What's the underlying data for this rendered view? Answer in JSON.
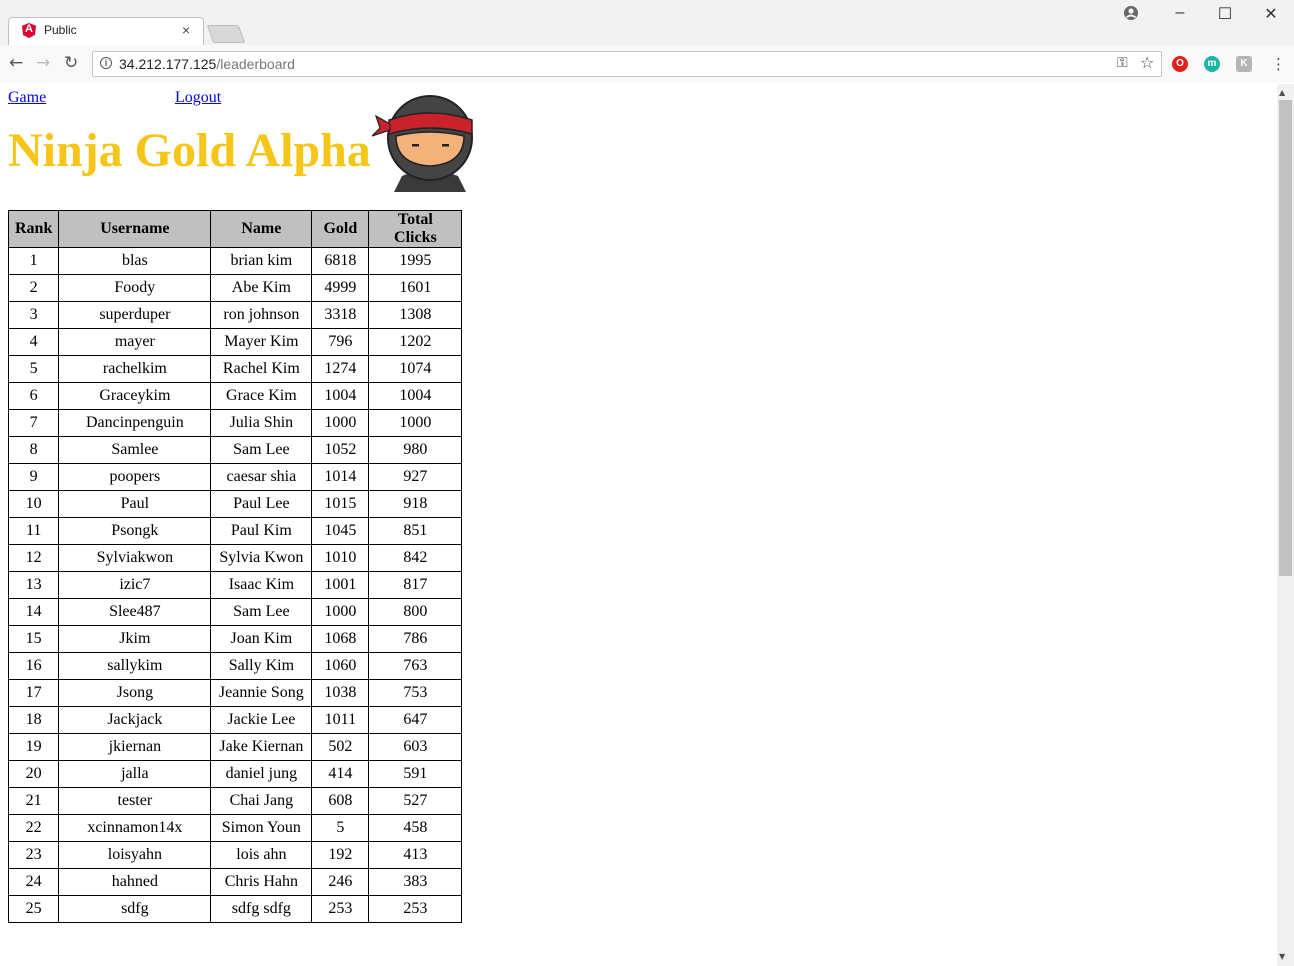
{
  "browser": {
    "tab_title": "Public",
    "tab_close": "×",
    "url_host": "34.212.177.125",
    "url_path": "/leaderboard",
    "window_controls": [
      "–",
      "☐",
      "✕"
    ]
  },
  "nav": {
    "game_link": "Game",
    "logout_link": "Logout"
  },
  "page": {
    "title": "Ninja Gold Alpha"
  },
  "table": {
    "headers": [
      "Rank",
      "Username",
      "Name",
      "Gold",
      "Total Clicks"
    ],
    "rows": [
      [
        "1",
        "blas",
        "brian kim",
        "6818",
        "1995"
      ],
      [
        "2",
        "Foody",
        "Abe Kim",
        "4999",
        "1601"
      ],
      [
        "3",
        "superduper",
        "ron johnson",
        "3318",
        "1308"
      ],
      [
        "4",
        "mayer",
        "Mayer Kim",
        "796",
        "1202"
      ],
      [
        "5",
        "rachelkim",
        "Rachel Kim",
        "1274",
        "1074"
      ],
      [
        "6",
        "Graceykim",
        "Grace Kim",
        "1004",
        "1004"
      ],
      [
        "7",
        "Dancinpenguin",
        "Julia Shin",
        "1000",
        "1000"
      ],
      [
        "8",
        "Samlee",
        "Sam Lee",
        "1052",
        "980"
      ],
      [
        "9",
        "poopers",
        "caesar shia",
        "1014",
        "927"
      ],
      [
        "10",
        "Paul",
        "Paul Lee",
        "1015",
        "918"
      ],
      [
        "11",
        "Psongk",
        "Paul Kim",
        "1045",
        "851"
      ],
      [
        "12",
        "Sylviakwon",
        "Sylvia Kwon",
        "1010",
        "842"
      ],
      [
        "13",
        "izic7",
        "Isaac Kim",
        "1001",
        "817"
      ],
      [
        "14",
        "Slee487",
        "Sam Lee",
        "1000",
        "800"
      ],
      [
        "15",
        "Jkim",
        "Joan Kim",
        "1068",
        "786"
      ],
      [
        "16",
        "sallykim",
        "Sally Kim",
        "1060",
        "763"
      ],
      [
        "17",
        "Jsong",
        "Jeannie Song",
        "1038",
        "753"
      ],
      [
        "18",
        "Jackjack",
        "Jackie Lee",
        "1011",
        "647"
      ],
      [
        "19",
        "jkiernan",
        "Jake Kiernan",
        "502",
        "603"
      ],
      [
        "20",
        "jalla",
        "daniel jung",
        "414",
        "591"
      ],
      [
        "21",
        "tester",
        "Chai Jang",
        "608",
        "527"
      ],
      [
        "22",
        "xcinnamon14x",
        "Simon Youn",
        "5",
        "458"
      ],
      [
        "23",
        "loisyahn",
        "lois ahn",
        "192",
        "413"
      ],
      [
        "24",
        "hahned",
        "Chris Hahn",
        "246",
        "383"
      ],
      [
        "25",
        "sdfg",
        "sdfg sdfg",
        "253",
        "253"
      ]
    ]
  },
  "colors": {
    "title": "#f5c518",
    "header_bg": "#c0c0c0",
    "link": "#0000ee"
  }
}
